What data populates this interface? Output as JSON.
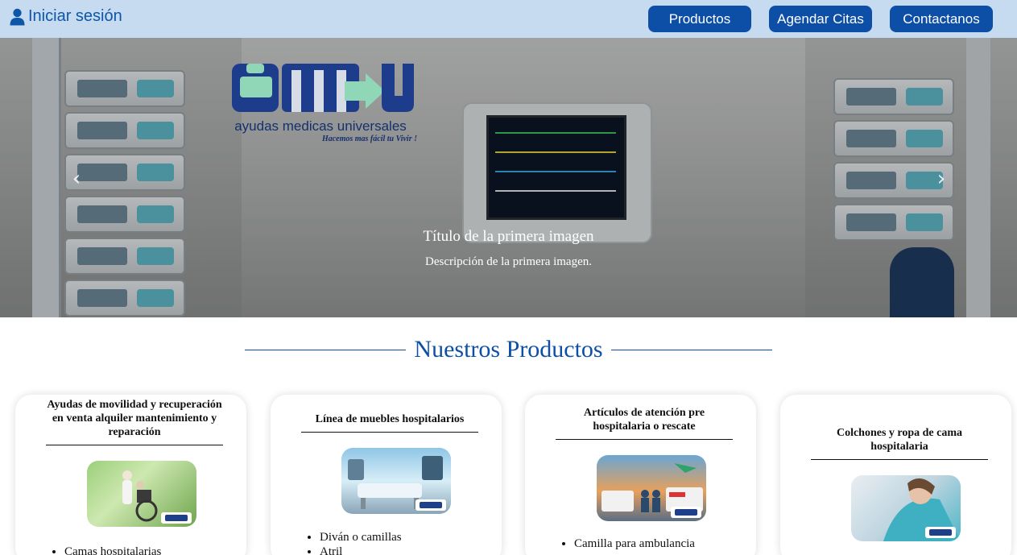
{
  "nav": {
    "login_label": "Iniciar sesión",
    "buttons": [
      "Productos",
      "Agendar Citas",
      "Contactanos"
    ]
  },
  "hero": {
    "logo_text": "ayudas medicas universales",
    "logo_slogan": "Hacemos mas fácil tu Vivir !",
    "caption_title": "Título de la primera imagen",
    "caption_desc": "Descripción de la primera imagen.",
    "prev_icon": "‹",
    "next_icon": "›"
  },
  "section": {
    "title": "Nuestros Productos"
  },
  "cards": [
    {
      "title": "Ayudas de movilidad y recuperación en venta alquiler mantenimiento y reparación",
      "items": [
        "Camas hospitalarias"
      ]
    },
    {
      "title": "Línea de muebles hospitalarios",
      "items": [
        "Diván o camillas",
        "Atril"
      ]
    },
    {
      "title": "Artículos de atención pre hospitalaria o rescate",
      "items": [
        "Camilla para ambulancia"
      ]
    },
    {
      "title": "Colchones y ropa de cama hospitalaria",
      "items": []
    }
  ],
  "colors": {
    "nav_bg": "#c6dbf0",
    "primary": "#0d4fa6"
  }
}
